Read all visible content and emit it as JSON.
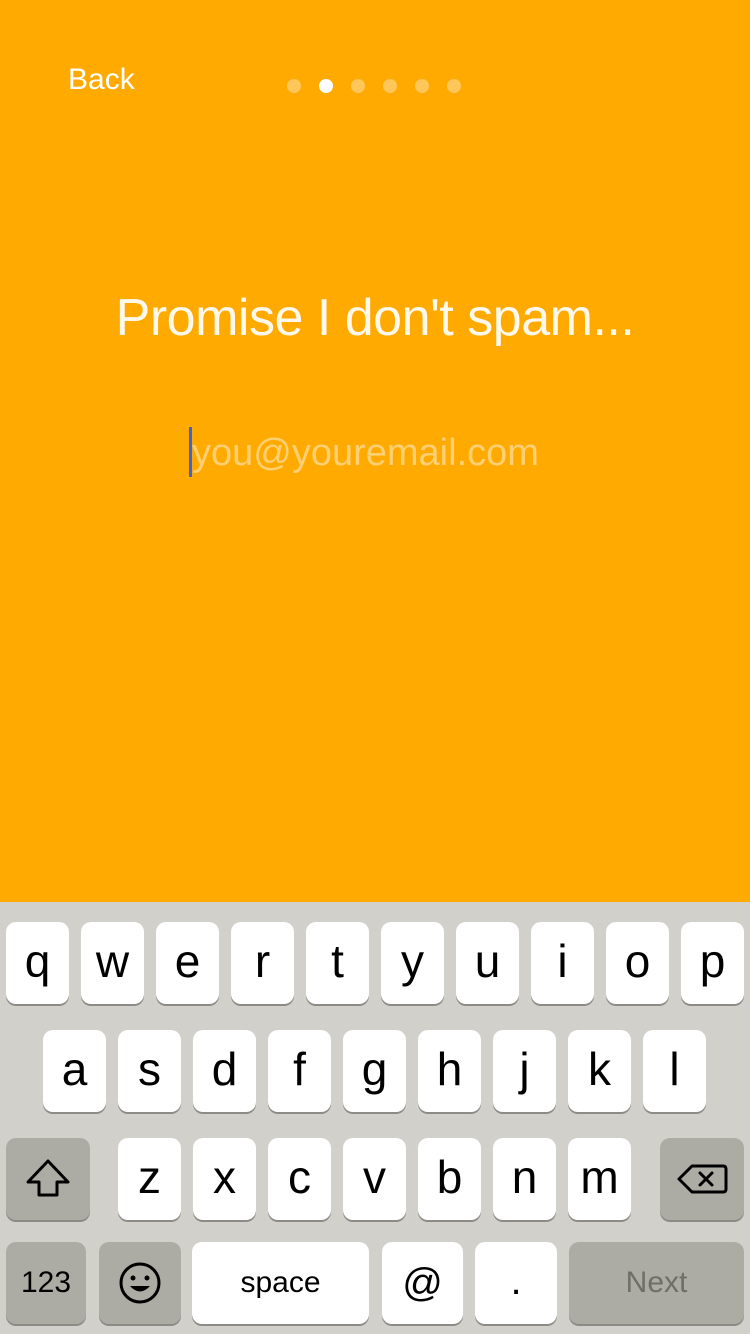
{
  "header": {
    "back_label": "Back",
    "page_dots": {
      "count": 6,
      "active_index": 1
    }
  },
  "main": {
    "headline": "Promise I don't spam...",
    "email_placeholder": "you@youremail.com",
    "email_value": ""
  },
  "keyboard": {
    "row1": [
      "q",
      "w",
      "e",
      "r",
      "t",
      "y",
      "u",
      "i",
      "o",
      "p"
    ],
    "row2": [
      "a",
      "s",
      "d",
      "f",
      "g",
      "h",
      "j",
      "k",
      "l"
    ],
    "row3": [
      "z",
      "x",
      "c",
      "v",
      "b",
      "n",
      "m"
    ],
    "numbers_label": "123",
    "space_label": "space",
    "at_label": "@",
    "dot_label": ".",
    "next_label": "Next",
    "icons": {
      "shift": "shift-icon",
      "delete": "backspace-icon",
      "emoji": "emoji-icon"
    }
  },
  "colors": {
    "background": "#FFAA00",
    "keyboard_bg": "#D2D0CA",
    "caret": "#3B63E6"
  }
}
